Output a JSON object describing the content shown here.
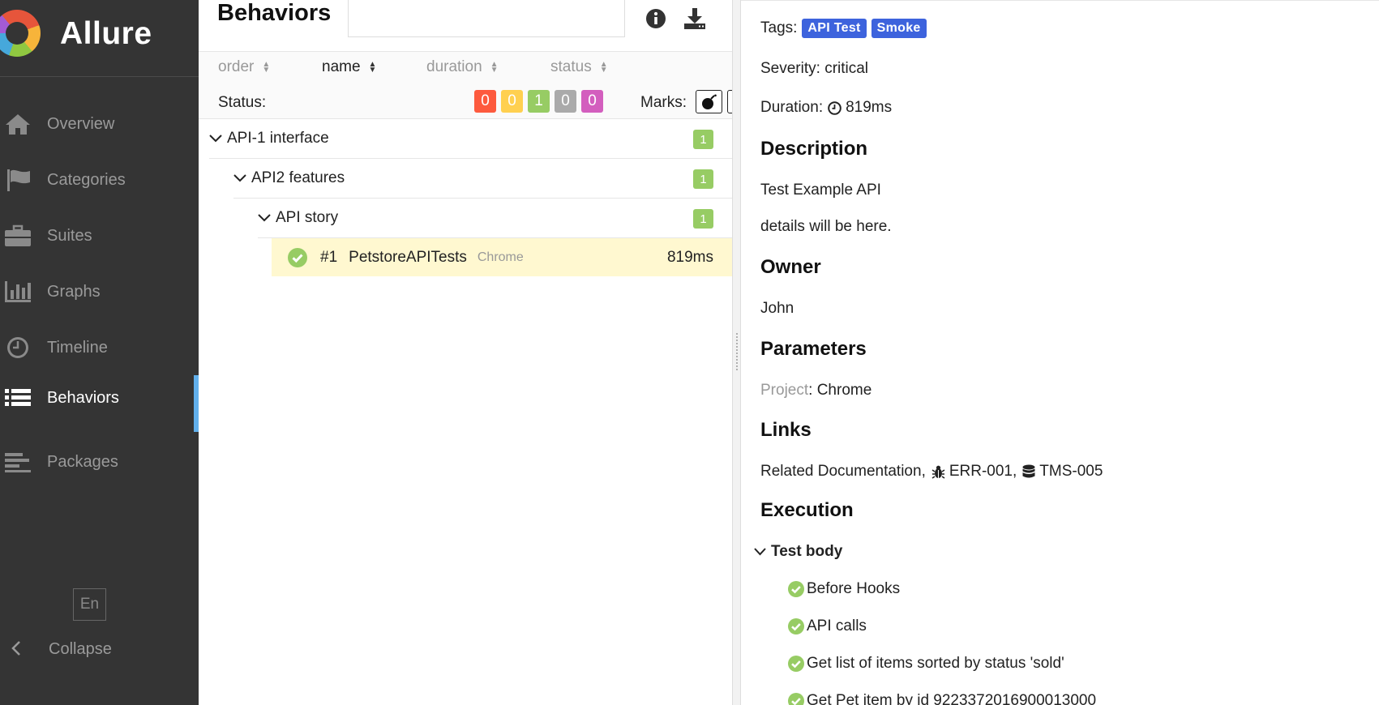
{
  "app": {
    "name": "Allure"
  },
  "sidebar": {
    "items": [
      {
        "label": "Overview",
        "icon": "home-icon"
      },
      {
        "label": "Categories",
        "icon": "flag-icon"
      },
      {
        "label": "Suites",
        "icon": "briefcase-icon"
      },
      {
        "label": "Graphs",
        "icon": "bar-chart-icon"
      },
      {
        "label": "Timeline",
        "icon": "clock-icon"
      },
      {
        "label": "Behaviors",
        "icon": "list-icon",
        "active": true
      },
      {
        "label": "Packages",
        "icon": "align-left-icon"
      }
    ],
    "language": "En",
    "collapse_label": "Collapse"
  },
  "behaviors": {
    "title": "Behaviors",
    "search_value": "",
    "sort": {
      "columns": [
        "order",
        "name",
        "duration",
        "status"
      ],
      "active": "name"
    },
    "status_label": "Status:",
    "status_counts": [
      {
        "value": "0",
        "color": "#fd5a3e",
        "status": "failed"
      },
      {
        "value": "0",
        "color": "#ffd050",
        "status": "broken"
      },
      {
        "value": "1",
        "color": "#97cc64",
        "status": "passed"
      },
      {
        "value": "0",
        "color": "#aaaaaa",
        "status": "skipped"
      },
      {
        "value": "0",
        "color": "#d35ebe",
        "status": "unknown"
      }
    ],
    "marks_label": "Marks:",
    "marks": [
      "flaky-bomb-icon",
      "new-failed-icon",
      "new-passed-icon",
      "new-broken-icon",
      "retries-icon"
    ],
    "tree": [
      {
        "label": "API-1 interface",
        "count": "1"
      },
      {
        "label": "API2 features",
        "count": "1"
      },
      {
        "label": "API story",
        "count": "1"
      }
    ],
    "leaf": {
      "order": "#1",
      "name": "PetstoreAPITests",
      "parameter": "Chrome",
      "duration": "819ms"
    }
  },
  "details": {
    "tags_label": "Tags:",
    "tags": [
      "API Test",
      "Smoke"
    ],
    "severity": "Severity: critical",
    "duration_label": "Duration:",
    "duration_value": "819ms",
    "description_heading": "Description",
    "description_lines": [
      "Test Example API",
      "details will be here."
    ],
    "owner_heading": "Owner",
    "owner": "John",
    "parameters_heading": "Parameters",
    "parameter_name": "Project",
    "parameter_value": ": Chrome",
    "links_heading": "Links",
    "links": {
      "doc": "Related Documentation",
      "sep1": " ,",
      "issue": "ERR-001",
      "sep2": " ,",
      "tms": "TMS-005"
    },
    "execution_heading": "Execution",
    "test_body_label": "Test body",
    "steps": [
      "Before Hooks",
      "API calls",
      "Get list of items sorted by status 'sold'",
      "Get Pet item by id 9223372016900013000"
    ]
  },
  "colors": {
    "passed": "#97cc64",
    "accent": "#62b0ec",
    "tag": "#3d63dd",
    "sidebar": "#343434",
    "selected_row": "#fff8d0"
  }
}
